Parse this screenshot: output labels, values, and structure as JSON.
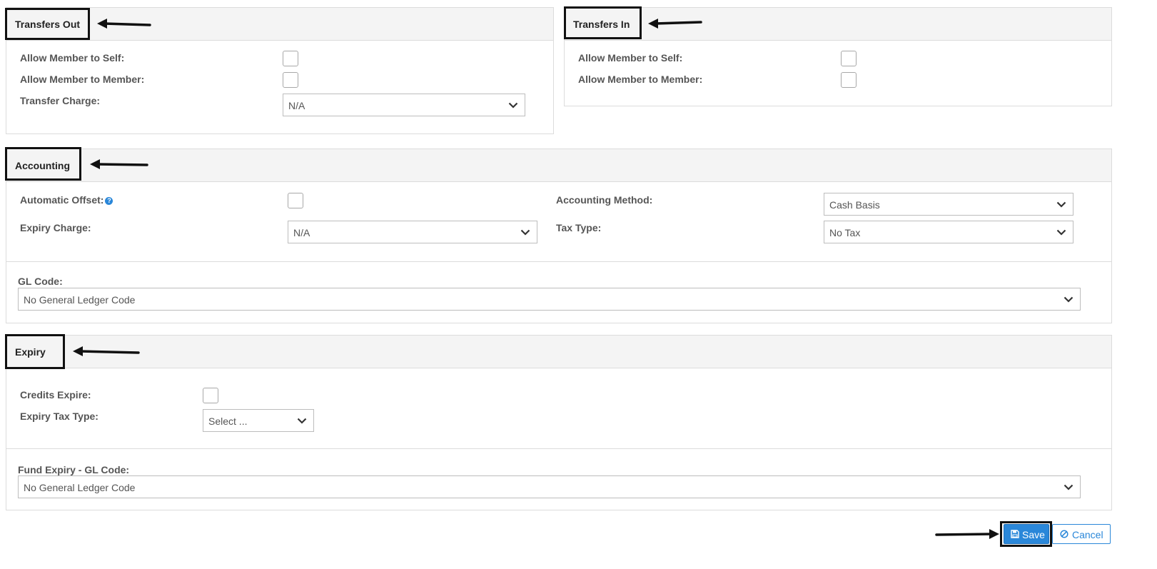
{
  "transfers_out": {
    "title": "Transfers Out",
    "member_to_self_label": "Allow Member to Self:",
    "member_to_member_label": "Allow Member to Member:",
    "transfer_charge_label": "Transfer Charge:",
    "transfer_charge_value": "N/A"
  },
  "transfers_in": {
    "title": "Transfers In",
    "member_to_self_label": "Allow Member to Self:",
    "member_to_member_label": "Allow Member to Member:"
  },
  "accounting": {
    "title": "Accounting",
    "automatic_offset_label": "Automatic Offset:",
    "expiry_charge_label": "Expiry Charge:",
    "expiry_charge_value": "N/A",
    "accounting_method_label": "Accounting Method:",
    "accounting_method_value": "Cash Basis",
    "tax_type_label": "Tax Type:",
    "tax_type_value": "No Tax",
    "gl_code_label": "GL Code:",
    "gl_code_value": "No General Ledger Code"
  },
  "expiry": {
    "title": "Expiry",
    "credits_expire_label": "Credits Expire:",
    "expiry_tax_type_label": "Expiry Tax Type:",
    "expiry_tax_type_value": "Select ...",
    "fund_expiry_gl_label": "Fund Expiry - GL Code:",
    "fund_expiry_gl_value": "No General Ledger Code"
  },
  "actions": {
    "save_label": "Save",
    "cancel_label": "Cancel"
  },
  "icons": {
    "chevron": "chevron-down-icon",
    "help": "help-icon",
    "save": "floppy-disk-icon",
    "cancel": "ban-icon",
    "arrow": "arrow-left-icon"
  },
  "colors": {
    "accent": "#2a87d9",
    "header_bg": "#f4f4f4",
    "border": "#dcdcdc",
    "annotation": "#111111"
  }
}
